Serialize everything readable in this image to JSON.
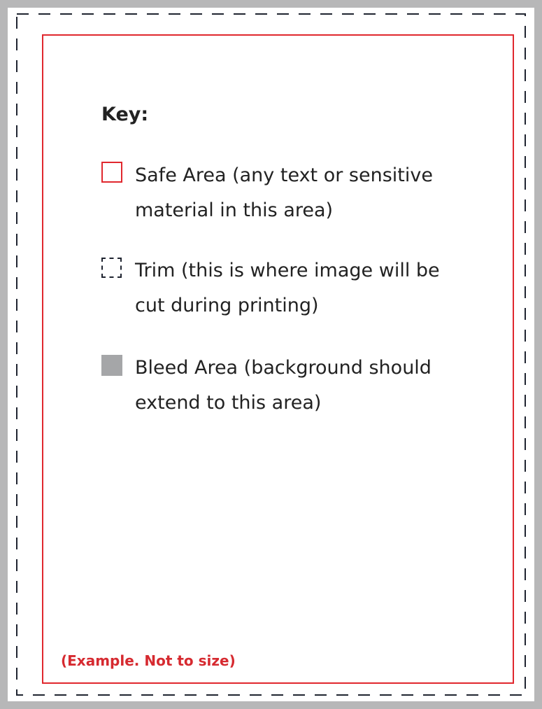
{
  "colors": {
    "bleed": "#b7b7b8",
    "bleed_swatch": "#a5a6a8",
    "safe_border": "#e0282e",
    "trim_line": "#1f2430",
    "text": "#222222",
    "note": "#d62a30"
  },
  "key": {
    "title": "Key:",
    "items": [
      {
        "icon": "safe-area-swatch-icon",
        "line1": "Safe Area (any text or sensitive",
        "line2": "material in this area)"
      },
      {
        "icon": "trim-swatch-icon",
        "line1": "Trim (this is where image will be",
        "line2": "cut during printing)"
      },
      {
        "icon": "bleed-area-swatch-icon",
        "line1": "Bleed Area (background should",
        "line2": "extend to this area)"
      }
    ]
  },
  "note": "(Example. Not to size)"
}
